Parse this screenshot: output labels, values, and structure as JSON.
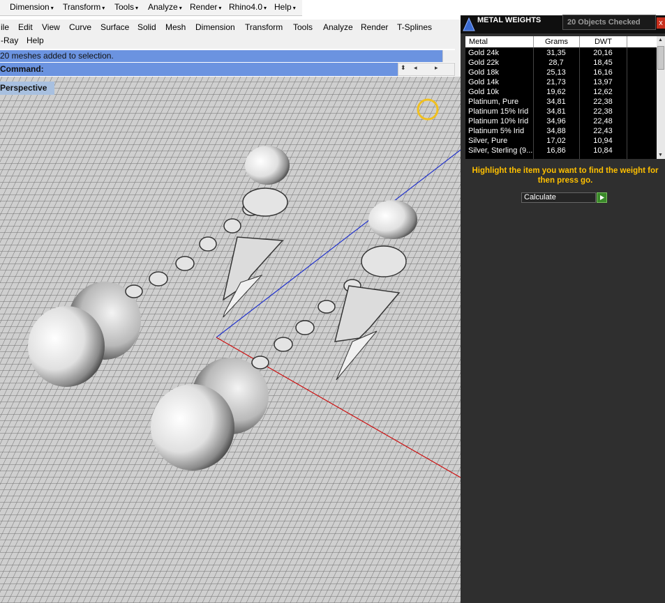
{
  "toolbar_menu": {
    "items": [
      {
        "label": "Dimension"
      },
      {
        "label": "Transform"
      },
      {
        "label": "Tools"
      },
      {
        "label": "Analyze"
      },
      {
        "label": "Render"
      },
      {
        "label": "Rhino4.0"
      },
      {
        "label": "Help"
      }
    ]
  },
  "menubar": {
    "row1": [
      "ile",
      "Edit",
      "View",
      "Curve",
      "Surface",
      "Solid",
      "Mesh",
      "Dimension",
      "Transform",
      "Tools",
      "Analyze",
      "Render",
      "T-Splines"
    ],
    "row2": [
      "-Ray",
      "Help"
    ]
  },
  "command": {
    "history": "20 meshes added to selection.",
    "prompt": "Command:"
  },
  "viewport": {
    "title": "Perspective"
  },
  "panel": {
    "title": "METAL WEIGHTS",
    "status": "20 Objects Checked",
    "close": "x",
    "columns": [
      "Metal",
      "Grams",
      "DWT"
    ],
    "rows": [
      {
        "metal": "Gold 24k",
        "grams": "31,35",
        "dwt": "20,16"
      },
      {
        "metal": "Gold 22k",
        "grams": "28,7",
        "dwt": "18,45"
      },
      {
        "metal": "Gold 18k",
        "grams": "25,13",
        "dwt": "16,16"
      },
      {
        "metal": "Gold 14k",
        "grams": "21,73",
        "dwt": "13,97"
      },
      {
        "metal": "Gold 10k",
        "grams": "19,62",
        "dwt": "12,62"
      },
      {
        "metal": "Platinum, Pure",
        "grams": "34,81",
        "dwt": "22,38"
      },
      {
        "metal": "Platinum 15% Irid",
        "grams": "34,81",
        "dwt": "22,38"
      },
      {
        "metal": "Platinum 10% Irid",
        "grams": "34,96",
        "dwt": "22,48"
      },
      {
        "metal": "Platinum 5% Irid",
        "grams": "34,88",
        "dwt": "22,43"
      },
      {
        "metal": "Silver, Pure",
        "grams": "17,02",
        "dwt": "10,94"
      },
      {
        "metal": "Silver, Sterling (9...",
        "grams": "16,86",
        "dwt": "10,84"
      }
    ],
    "hint": "Highlight the item you want to find the weight for then press go.",
    "select_value": "Calculate",
    "colors": {
      "hint": "#ffc000",
      "panel": "#2f2f2f",
      "command_bar": "#6b93e0"
    }
  }
}
